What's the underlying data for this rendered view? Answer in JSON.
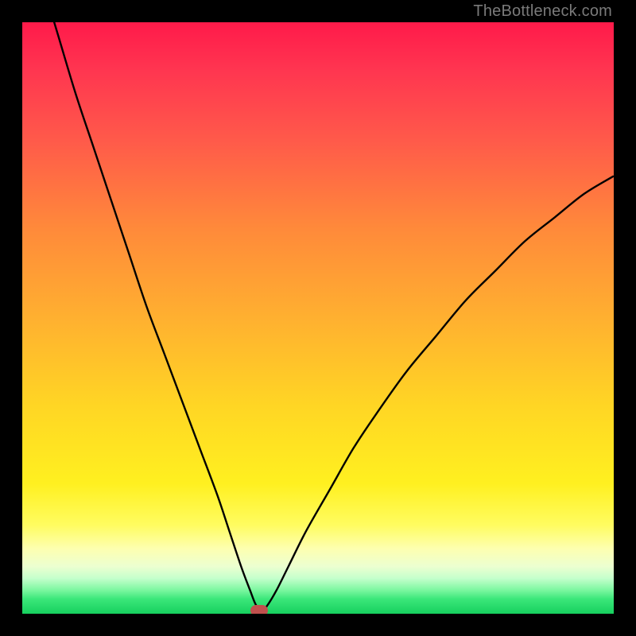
{
  "watermark": "TheBottleneck.com",
  "colors": {
    "frame": "#000000",
    "curve": "#000000",
    "marker": "#c0504d",
    "gradient_top": "#ff1a4a",
    "gradient_bottom": "#16d05e"
  },
  "chart_data": {
    "type": "line",
    "title": "",
    "xlabel": "",
    "ylabel": "",
    "xlim": [
      0,
      100
    ],
    "ylim": [
      0,
      100
    ],
    "axes_visible": false,
    "grid": false,
    "notes": "V-shaped bottleneck curve over rainbow heat gradient; curve is percent-mismatch vs. component scale. Minimum (best match) near x≈40.",
    "series": [
      {
        "name": "bottleneck-curve",
        "x": [
          0,
          3,
          6,
          9,
          12,
          15,
          18,
          21,
          24,
          27,
          30,
          33,
          35,
          37,
          38.5,
          39.5,
          40.5,
          41.5,
          43,
          45,
          48,
          52,
          56,
          60,
          65,
          70,
          75,
          80,
          85,
          90,
          95,
          100
        ],
        "y": [
          118,
          108,
          98,
          88,
          79,
          70,
          61,
          52,
          44,
          36,
          28,
          20,
          14,
          8,
          4,
          1.5,
          0.5,
          1.5,
          4,
          8,
          14,
          21,
          28,
          34,
          41,
          47,
          53,
          58,
          63,
          67,
          71,
          74
        ]
      }
    ],
    "marker": {
      "x": 40,
      "y": 0.5
    }
  }
}
